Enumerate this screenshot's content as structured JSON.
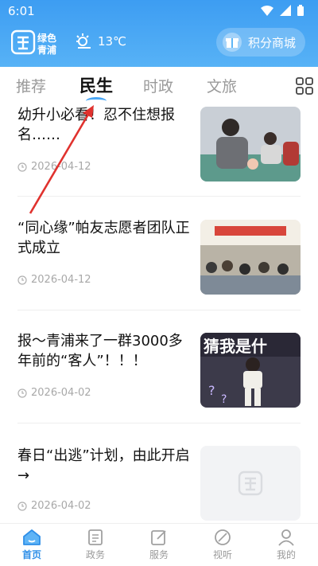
{
  "status": {
    "time": "6:01"
  },
  "header": {
    "weather_temp": "13℃",
    "mall_label": "积分商城"
  },
  "tabs": [
    {
      "label": "推荐"
    },
    {
      "label": "民生"
    },
    {
      "label": "时政"
    },
    {
      "label": "文旅"
    }
  ],
  "news": [
    {
      "title": "幼升小必看！忍不住想报名……",
      "date": "2026-04-12"
    },
    {
      "title": "“同心缘”帕友志愿者团队正式成立",
      "date": "2026-04-12"
    },
    {
      "title": "报～青浦来了一群3000多年前的“客人”！！！",
      "date": "2026-04-02",
      "thumb_caption": "猜我是什"
    },
    {
      "title": "春日“出逃”计划，由此开启→",
      "date": "2026-04-02"
    }
  ],
  "bottom_nav": [
    {
      "label": "首页"
    },
    {
      "label": "政务"
    },
    {
      "label": "服务"
    },
    {
      "label": "视听"
    },
    {
      "label": "我的"
    }
  ],
  "colors": {
    "accent": "#3d9df2",
    "annotation": "#e0322e"
  }
}
